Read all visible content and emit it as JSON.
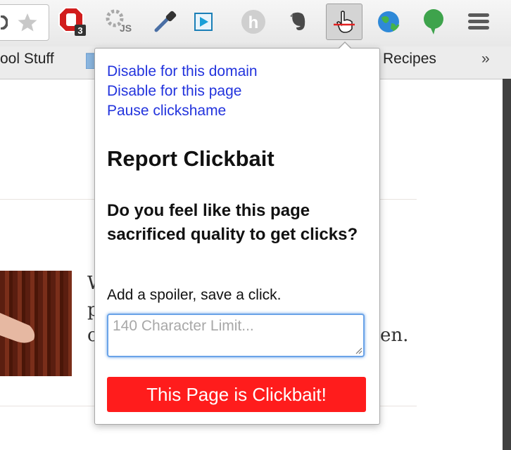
{
  "toolbar": {
    "adblock_badge": "3",
    "extensions": [
      "adblock-icon",
      "script-js-icon",
      "eyedropper-icon",
      "play-icon",
      "h-icon",
      "evernote-icon",
      "clickshame-icon",
      "globe-icon",
      "speech-bubble-icon",
      "menu-icon"
    ]
  },
  "bookmarks": {
    "left_label": "ool Stuff",
    "right_label": "Recipes",
    "overflow": "»"
  },
  "page": {
    "fragment_1": "W",
    "fragment_2": "p",
    "fragment_3": "c",
    "fragment_4": "en."
  },
  "popup": {
    "links": [
      "Disable for this domain",
      "Disable for this page",
      "Pause clickshame"
    ],
    "heading": "Report Clickbait",
    "question": "Do you feel like this page sacrificed quality to get clicks?",
    "spoiler_label": "Add a spoiler, save a click.",
    "spoiler_placeholder": "140 Character Limit...",
    "spoiler_value": "",
    "button_label": "This Page is Clickbait!",
    "colors": {
      "link": "#2233dd",
      "button": "#ff1c1c",
      "focus": "#6aa3e8"
    }
  }
}
